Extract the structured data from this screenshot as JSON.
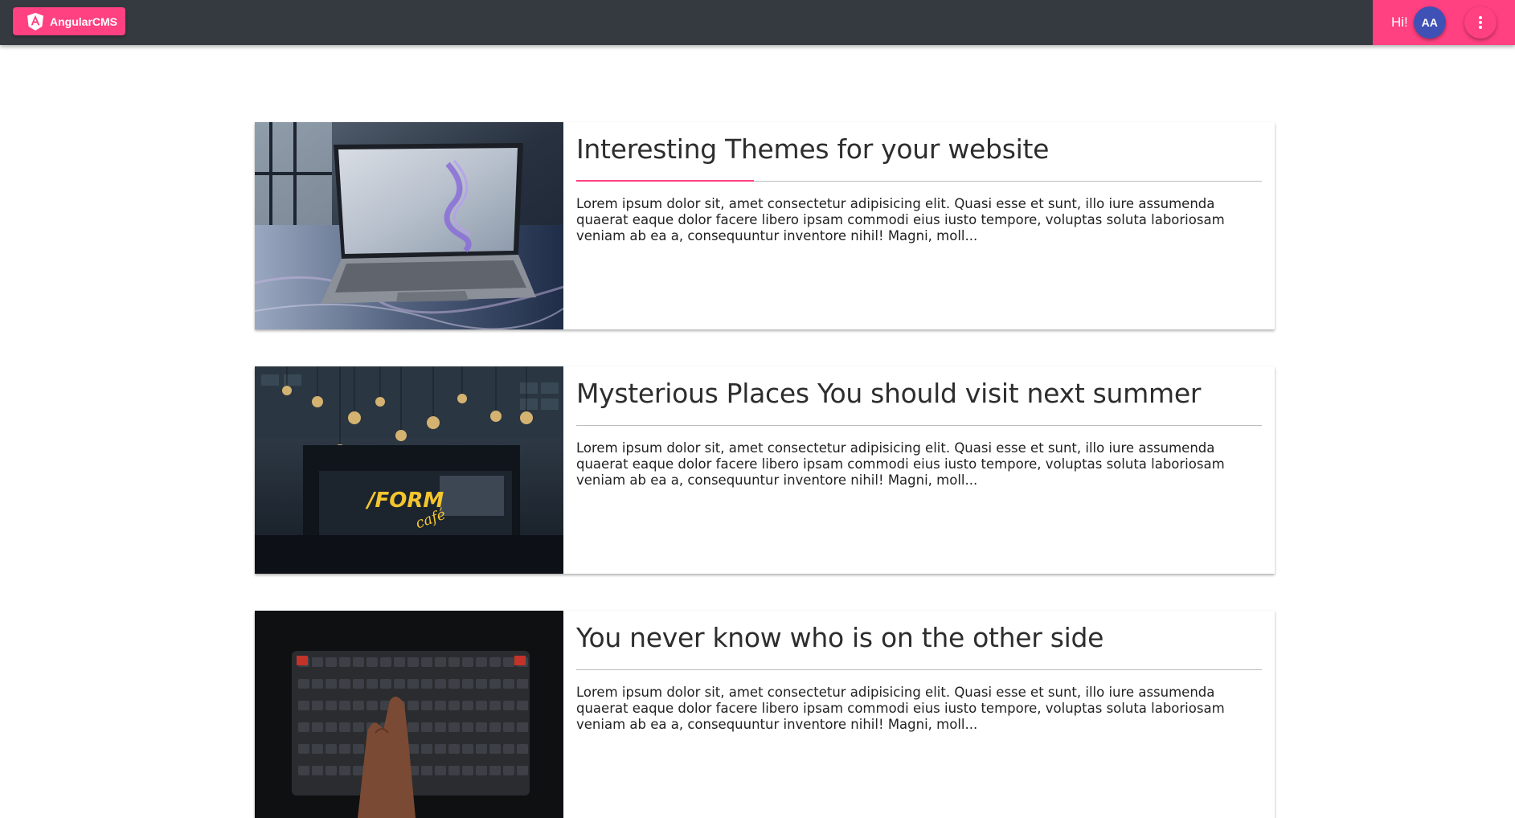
{
  "header": {
    "brand_label": "AngularCMS",
    "greeting": "Hi!",
    "avatar_initials": "AA",
    "menu_icon": "more-vert-icon",
    "colors": {
      "toolbar": "#353a40",
      "accent": "#ff4081",
      "avatar": "#3f51b5"
    }
  },
  "posts": [
    {
      "title": "Interesting Themes for your website",
      "excerpt": "Lorem ipsum dolor sit, amet consectetur adipisicing elit. Quasi esse et sunt, illo iure assumenda quaerat eaque dolor facere libero ipsam commodi eius iusto tempore, voluptas soluta laboriosam veniam ab ea a, consequuntur inventore nihil! Magni, moll..."
    },
    {
      "title": "Mysterious Places You should visit next summer",
      "excerpt": "Lorem ipsum dolor sit, amet consectetur adipisicing elit. Quasi esse et sunt, illo iure assumenda quaerat eaque dolor facere libero ipsam commodi eius iusto tempore, voluptas soluta laboriosam veniam ab ea a, consequuntur inventore nihil! Magni, moll...",
      "image_sign_text": "/FORM café"
    },
    {
      "title": "You never know who is on the other side",
      "excerpt": "Lorem ipsum dolor sit, amet consectetur adipisicing elit. Quasi esse et sunt, illo iure assumenda quaerat eaque dolor facere libero ipsam commodi eius iusto tempore, voluptas soluta laboriosam veniam ab ea a, consequuntur inventore nihil! Magni, moll..."
    }
  ]
}
